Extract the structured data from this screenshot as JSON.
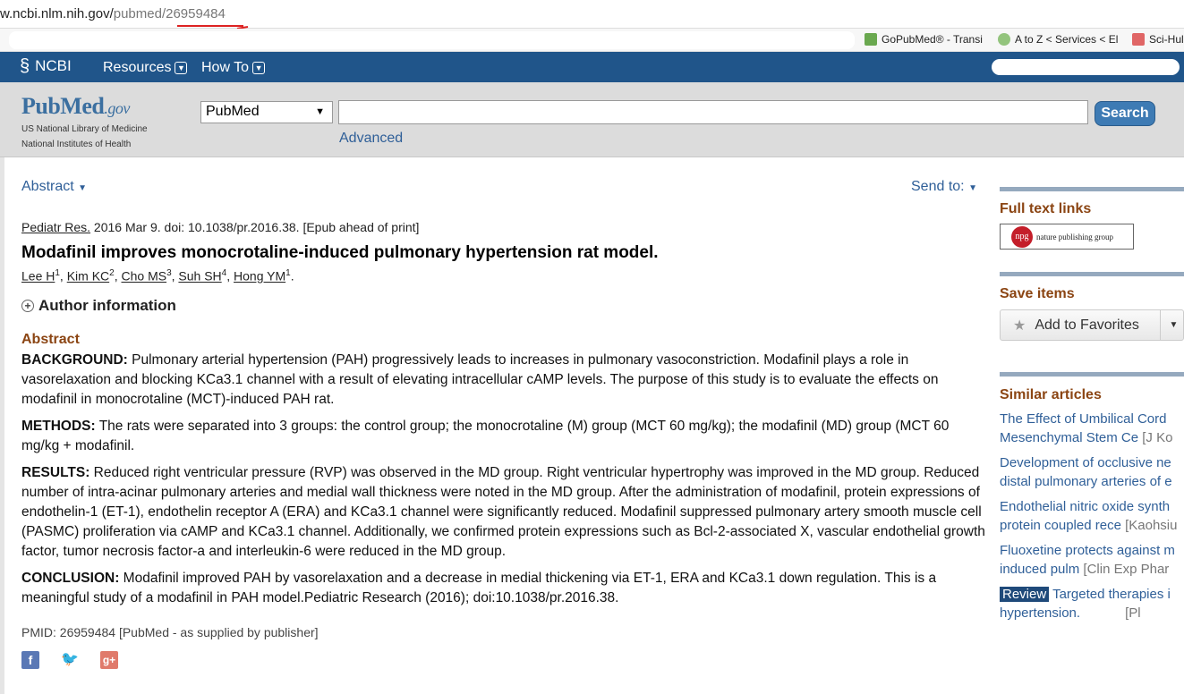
{
  "browser": {
    "url_host": "w.ncbi.nlm.nih.gov/",
    "url_path": "pubmed/",
    "url_id": "26959484",
    "bookmarks": [
      {
        "label": "GoPubMed® - Transi",
        "icon": "green-grid-icon",
        "color": "#6aa84f"
      },
      {
        "label": "A to Z < Services < El",
        "icon": "green-molecule-icon",
        "color": "#93c47d"
      },
      {
        "label": "Sci-Hul",
        "icon": "scihub-raven-icon",
        "color": "#e06666"
      }
    ]
  },
  "ncbi": {
    "logo": "NCBI",
    "menu": [
      "Resources",
      "How To"
    ]
  },
  "search": {
    "logo_text": "PubMed",
    "logo_gov": ".gov",
    "nlm_line1": "US National Library of Medicine",
    "nlm_line2": "National Institutes of Health",
    "database": "PubMed",
    "query": "",
    "button": "Search",
    "advanced": "Advanced"
  },
  "article": {
    "format_dropdown": "Abstract",
    "send_to": "Send to:",
    "journal": "Pediatr Res.",
    "citation_rest": " 2016 Mar 9. doi: 10.1038/pr.2016.38. [Epub ahead of print]",
    "title": "Modafinil improves monocrotaline-induced pulmonary hypertension rat model.",
    "authors": [
      {
        "name": "Lee H",
        "aff": "1"
      },
      {
        "name": "Kim KC",
        "aff": "2"
      },
      {
        "name": "Cho MS",
        "aff": "3"
      },
      {
        "name": "Suh SH",
        "aff": "4"
      },
      {
        "name": "Hong YM",
        "aff": "1"
      }
    ],
    "author_info": "Author information",
    "abstract_heading": "Abstract",
    "sections": [
      {
        "label": "BACKGROUND:",
        "text": " Pulmonary arterial hypertension (PAH) progressively leads to increases in pulmonary vasoconstriction. Modafinil plays a role in vasorelaxation and blocking KCa3.1 channel with a result of elevating intracellular cAMP levels. The purpose of this study is to evaluate the effects on modafinil in monocrotaline (MCT)-induced PAH rat."
      },
      {
        "label": "METHODS:",
        "text": " The rats were separated into 3 groups: the control group; the monocrotaline (M) group (MCT 60 mg/kg); the modafinil (MD) group (MCT 60 mg/kg + modafinil."
      },
      {
        "label": "RESULTS:",
        "text": " Reduced right ventricular pressure (RVP) was observed in the MD group. Right ventricular hypertrophy was improved in the MD group. Reduced number of intra-acinar pulmonary arteries and medial wall thickness were noted in the MD group. After the administration of modafinil, protein expressions of endothelin-1 (ET-1), endothelin receptor A (ERA) and KCa3.1 channel were significantly reduced. Modafinil suppressed pulmonary artery smooth muscle cell (PASMC) proliferation via cAMP and KCa3.1 channel. Additionally, we confirmed protein expressions such as Bcl-2-associated X, vascular endothelial growth factor, tumor necrosis factor-a and interleukin-6 were reduced in the MD group."
      },
      {
        "label": "CONCLUSION:",
        "text": " Modafinil improved PAH by vasorelaxation and a decrease in medial thickening via ET-1, ERA and KCa3.1 down regulation. This is a meaningful study of a modafinil in PAH model.Pediatric Research (2016); doi:10.1038/pr.2016.38."
      }
    ],
    "pmid_line": "PMID: 26959484 [PubMed - as supplied by publisher]",
    "social": [
      "f",
      "🐦",
      "g+"
    ]
  },
  "sidebar": {
    "full_text_heading": "Full text links",
    "npg_logo": "npg",
    "npg_text": "nature publishing group",
    "save_heading": "Save items",
    "add_favorites": "Add to Favorites",
    "similar_heading": "Similar articles",
    "similar": [
      {
        "line1": "The Effect of Umbilical Cord",
        "line2": "Mesenchymal Stem Ce",
        "src": " [J Ko"
      },
      {
        "line1": "Development of occlusive ne",
        "line2": "distal pulmonary arteries of e",
        "src": ""
      },
      {
        "line1": "Endothelial nitric oxide synth",
        "line2": "protein coupled rece",
        "src": " [Kaohsiu"
      },
      {
        "line1": "Fluoxetine protects against m",
        "line2": "induced pulm",
        "src": " [Clin Exp Phar"
      },
      {
        "badge": "Review",
        "line1": " Targeted therapies i",
        "line2": "hypertension.",
        "src": "            [Pl"
      }
    ]
  }
}
